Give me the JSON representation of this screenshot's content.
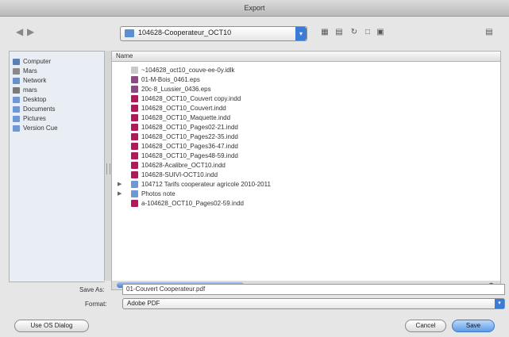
{
  "window": {
    "title": "Export"
  },
  "toolbar": {
    "back_icon": "back-arrow-icon",
    "forward_icon": "forward-arrow-icon",
    "path": "104628-Cooperateur_OCT10"
  },
  "sidebar": {
    "items": [
      {
        "label": "Computer",
        "icon": "computer-icon",
        "color": "#5a7fb4"
      },
      {
        "label": "Mars",
        "icon": "drive-icon",
        "color": "#8a8a8a"
      },
      {
        "label": "Network",
        "icon": "network-icon",
        "color": "#6c8fc4"
      },
      {
        "label": "mars",
        "icon": "user-icon",
        "color": "#7a7a7a"
      },
      {
        "label": "Desktop",
        "icon": "desktop-icon",
        "color": "#6e97d4"
      },
      {
        "label": "Documents",
        "icon": "folder-icon",
        "color": "#6e97d4"
      },
      {
        "label": "Pictures",
        "icon": "folder-icon",
        "color": "#6e97d4"
      },
      {
        "label": "Version Cue",
        "icon": "folder-icon",
        "color": "#6e97d4"
      }
    ]
  },
  "filelist": {
    "header": "Name",
    "rows": [
      {
        "name": "~104628_oct10_couve-ee-0y.idlk",
        "kind": "doc",
        "color": "#c9c9c9"
      },
      {
        "name": "01-M-Bois_0461.eps",
        "kind": "eps",
        "color": "#8b4a86"
      },
      {
        "name": "20c-8_Lussier_0436.eps",
        "kind": "eps",
        "color": "#8b4a86"
      },
      {
        "name": "104628_OCT10_Couvert copy.indd",
        "kind": "indd",
        "color": "#b01a5a"
      },
      {
        "name": "104628_OCT10_Couvert.indd",
        "kind": "indd",
        "color": "#b01a5a"
      },
      {
        "name": "104628_OCT10_Maquette.indd",
        "kind": "indd",
        "color": "#b01a5a"
      },
      {
        "name": "104628_OCT10_Pages02-21.indd",
        "kind": "indd",
        "color": "#b01a5a"
      },
      {
        "name": "104628_OCT10_Pages22-35.indd",
        "kind": "indd",
        "color": "#b01a5a"
      },
      {
        "name": "104628_OCT10_Pages36-47.indd",
        "kind": "indd",
        "color": "#b01a5a"
      },
      {
        "name": "104628_OCT10_Pages48-59.indd",
        "kind": "indd",
        "color": "#b01a5a"
      },
      {
        "name": "104628-Acalibre_OCT10.indd",
        "kind": "indd",
        "color": "#b01a5a"
      },
      {
        "name": "104628-SUIVI-OCT10.indd",
        "kind": "indd",
        "color": "#b01a5a"
      },
      {
        "name": "104712 Tarifs cooperateur agricole 2010-2011",
        "kind": "folder",
        "color": "#6e97d4",
        "expandable": true
      },
      {
        "name": "Photos note",
        "kind": "folder",
        "color": "#6e97d4",
        "expandable": true
      },
      {
        "name": "a-104628_OCT10_Pages02-59.indd",
        "kind": "indd",
        "color": "#b01a5a"
      }
    ]
  },
  "save_as": {
    "label": "Save As:",
    "value": "01-Couvert Cooperateur.pdf"
  },
  "format": {
    "label": "Format:",
    "value": "Adobe PDF"
  },
  "buttons": {
    "use_os_dialog": "Use OS Dialog",
    "cancel": "Cancel",
    "save": "Save"
  },
  "colors": {
    "accent": "#3b7bd6",
    "default_button": "#5c9cea"
  }
}
